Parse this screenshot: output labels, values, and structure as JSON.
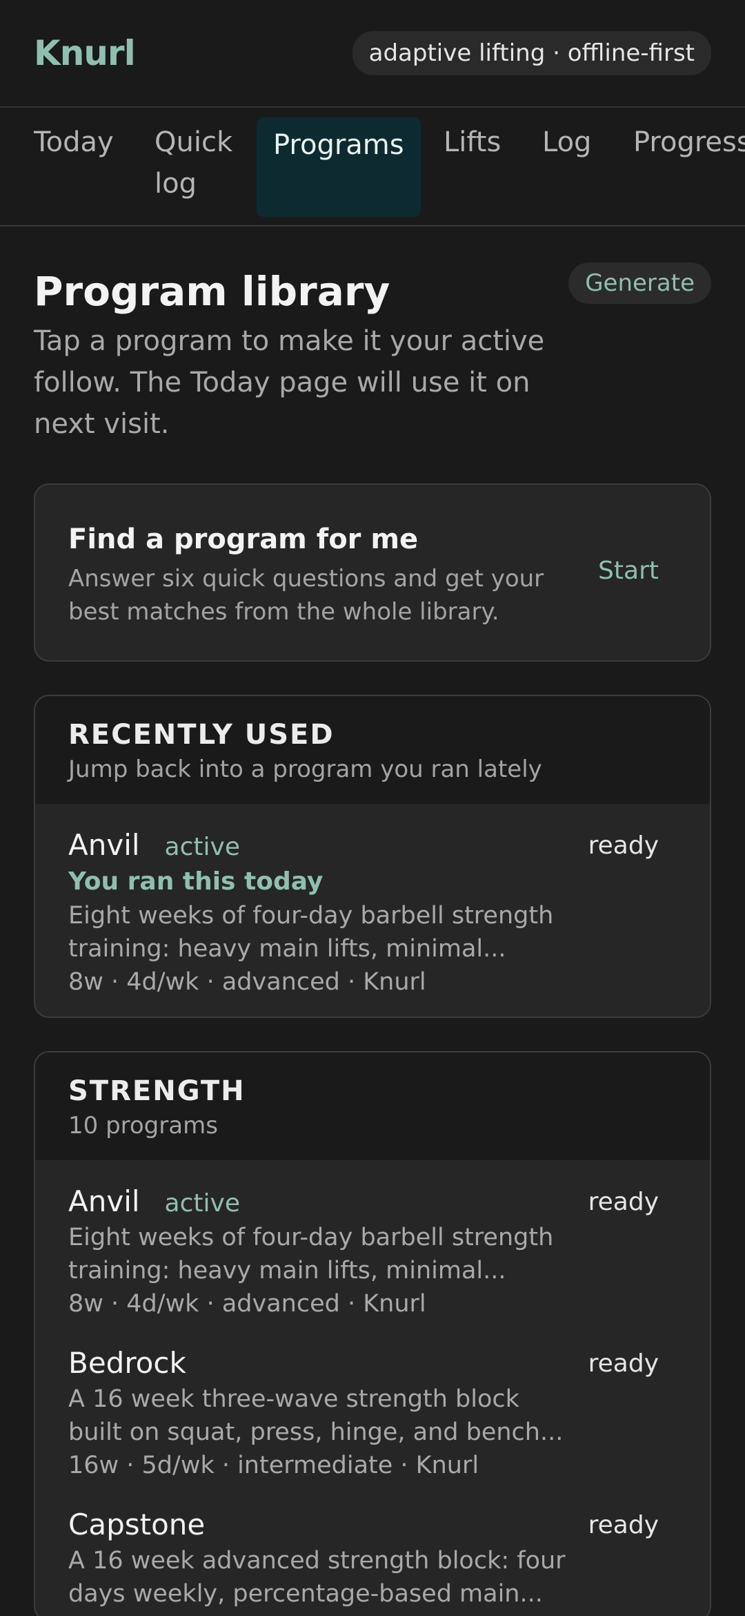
{
  "header": {
    "brand": "Knurl",
    "tagline": "adaptive lifting · offline-first"
  },
  "tabs": [
    {
      "label": "Today"
    },
    {
      "label": "Quick log"
    },
    {
      "label": "Programs",
      "active": true
    },
    {
      "label": "Lifts"
    },
    {
      "label": "Log"
    },
    {
      "label": "Progress"
    }
  ],
  "library": {
    "title": "Program library",
    "subtitle": "Tap a program to make it your active follow. The Today page will use it on next visit.",
    "generate_label": "Generate"
  },
  "finder": {
    "title": "Find a program for me",
    "description": "Answer six quick questions and get your best matches from the whole library.",
    "start_label": "Start"
  },
  "recent": {
    "title": "RECENTLY USED",
    "subtitle": "Jump back into a program you ran lately",
    "items": [
      {
        "name": "Anvil",
        "active_label": "active",
        "recent_note": "You ran this today",
        "status": "ready",
        "description": "Eight weeks of four-day barbell strength training: heavy main lifts, minimal...",
        "meta": "8w · 4d/wk · advanced · Knurl"
      }
    ]
  },
  "strength": {
    "title": "STRENGTH",
    "subtitle": "10 programs",
    "items": [
      {
        "name": "Anvil",
        "active_label": "active",
        "status": "ready",
        "description": "Eight weeks of four-day barbell strength training: heavy main lifts, minimal...",
        "meta": "8w · 4d/wk · advanced · Knurl"
      },
      {
        "name": "Bedrock",
        "status": "ready",
        "description": "A 16 week three-wave strength block built on squat, press, hinge, and bench...",
        "meta": "16w · 5d/wk · intermediate · Knurl"
      },
      {
        "name": "Capstone",
        "status": "ready",
        "description": "A 16 week advanced strength block: four days weekly, percentage-based main..."
      }
    ]
  }
}
